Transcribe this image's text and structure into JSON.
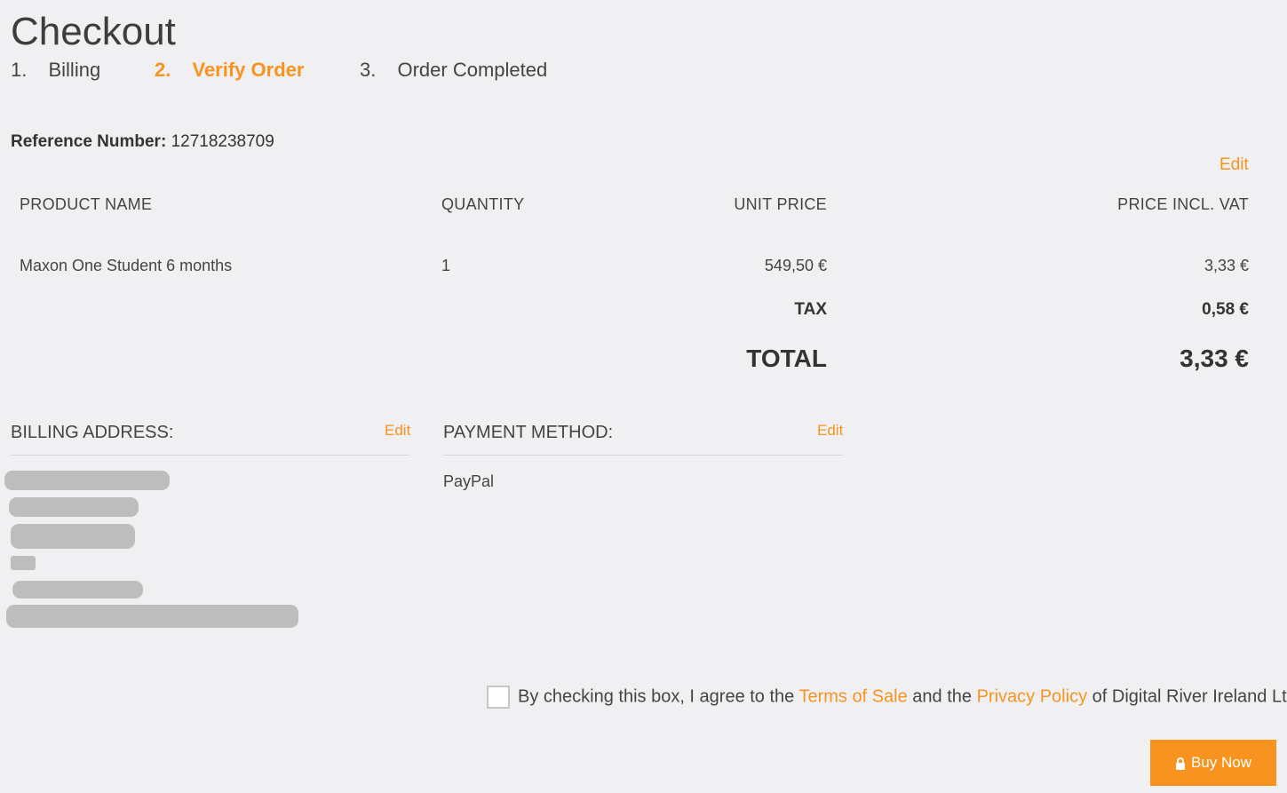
{
  "header": {
    "title": "Checkout"
  },
  "steps": [
    {
      "num": "1.",
      "label": "Billing",
      "active": false
    },
    {
      "num": "2.",
      "label": "Verify Order",
      "active": true
    },
    {
      "num": "3.",
      "label": "Order Completed",
      "active": false
    }
  ],
  "reference": {
    "label": "Reference Number:",
    "value": "12718238709"
  },
  "order": {
    "edit_label": "Edit",
    "columns": [
      "PRODUCT NAME",
      "QUANTITY",
      "UNIT PRICE",
      "PRICE INCL. VAT"
    ],
    "rows": [
      {
        "product": "Maxon One Student 6 months",
        "quantity": "1",
        "unit_price": "549,50 €",
        "price_incl_vat": "3,33 €"
      }
    ],
    "tax_label": "TAX",
    "tax_value": "0,58 €",
    "total_label": "TOTAL",
    "total_value": "3,33 €"
  },
  "billing": {
    "heading": "BILLING ADDRESS:",
    "edit_label": "Edit"
  },
  "payment": {
    "heading": "PAYMENT METHOD:",
    "edit_label": "Edit",
    "method": "PayPal"
  },
  "agreement": {
    "text_before": "By checking this box, I agree to the ",
    "terms_link": "Terms of Sale",
    "text_middle": " and the ",
    "privacy_link": "Privacy Policy",
    "text_after": " of Digital River Ireland Ltd..",
    "checked": false
  },
  "buy_button": {
    "label": "Buy Now",
    "icon": "lock-icon"
  },
  "colors": {
    "accent": "#f7931e",
    "background": "#f0f0f2",
    "redaction": "#bdbdbd"
  }
}
